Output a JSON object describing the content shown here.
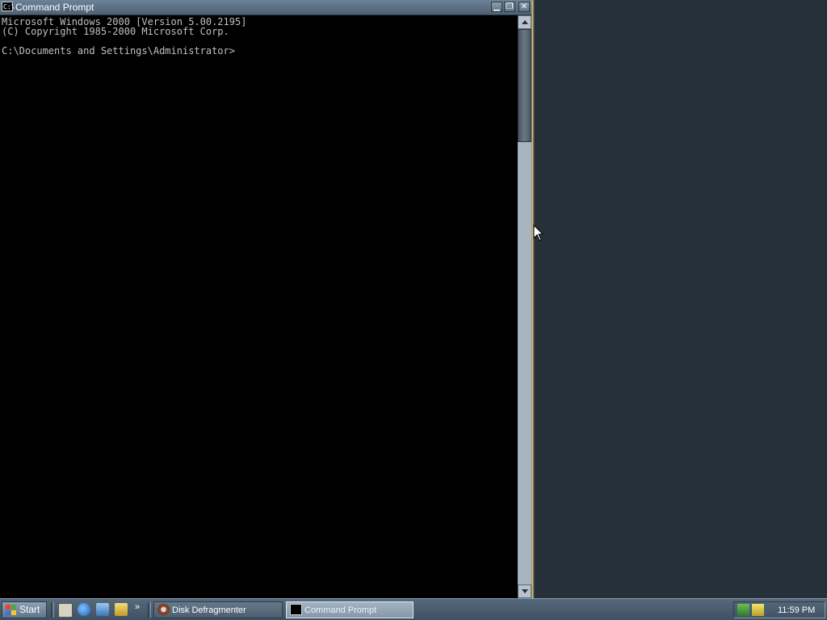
{
  "window": {
    "title": "Command Prompt",
    "icon_label": "C:\\",
    "controls": {
      "minimize": "minimize-icon",
      "restore": "restore-icon",
      "close": "close-icon"
    }
  },
  "console": {
    "lines": [
      "Microsoft Windows 2000 [Version 5.00.2195]",
      "(C) Copyright 1985-2000 Microsoft Corp.",
      "",
      "C:\\Documents and Settings\\Administrator>"
    ]
  },
  "taskbar": {
    "start_label": "Start",
    "quick_launch": [
      "show-desktop-icon",
      "internet-explorer-icon",
      "outlook-express-icon",
      "windows-explorer-icon"
    ],
    "more_label": "»",
    "tasks": [
      {
        "label": "Disk Defragmenter",
        "icon": "disk-defragmenter-icon",
        "active": false
      },
      {
        "label": "Command Prompt",
        "icon": "command-prompt-icon",
        "active": true
      }
    ],
    "tray_icons": [
      "network-icon",
      "volume-icon"
    ],
    "clock": "11:59 PM"
  },
  "colors": {
    "desktop": "#263039",
    "console_bg": "#000000",
    "console_text": "#c0c0c0",
    "titlebar": "#5d7185",
    "taskbar": "#4a5c6e"
  }
}
